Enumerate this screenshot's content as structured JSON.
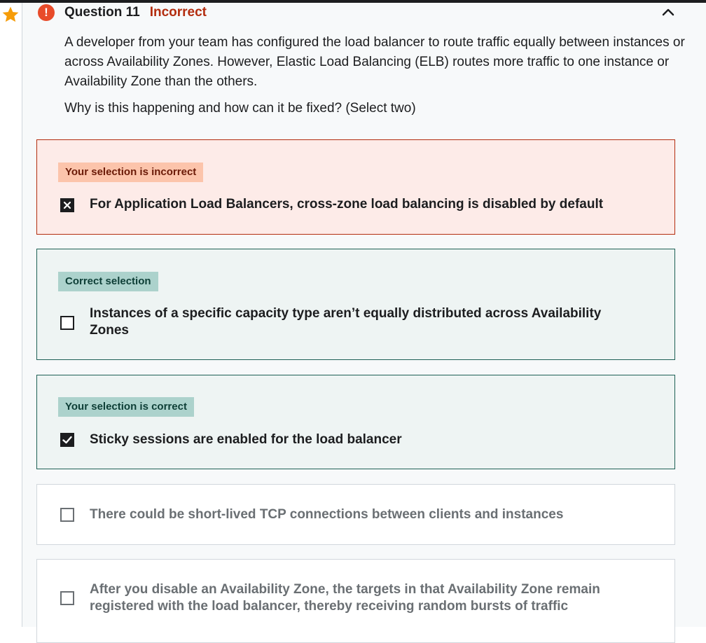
{
  "question": {
    "number_label": "Question 11",
    "status_label": "Incorrect",
    "text": "A developer from your team has configured the load balancer to route traffic equally between instances or across Availability Zones. However, Elastic Load Balancing (ELB) routes more traffic to one instance or Availability Zone than the others.",
    "prompt": "Why is this happening and how can it be fixed? (Select two)"
  },
  "icons": {
    "bookmark": "star-icon",
    "status": "exclamation-icon",
    "collapse": "chevron-up-icon"
  },
  "colors": {
    "accent_star": "#f69c08",
    "incorrect": "#b32d0f",
    "incorrect_bg": "#fdebe8",
    "correct_border": "#1e6055",
    "correct_bg": "#eef4f3"
  },
  "options": [
    {
      "badge": "Your selection is incorrect",
      "label": "For Application Load Balancers, cross-zone load balancing is disabled by default",
      "checked": true,
      "state": "incorrect"
    },
    {
      "badge": "Correct selection",
      "label": "Instances of a specific capacity type aren’t equally distributed across Availability Zones",
      "checked": false,
      "state": "correct"
    },
    {
      "badge": "Your selection is correct",
      "label": "Sticky sessions are enabled for the load balancer",
      "checked": true,
      "state": "correct"
    },
    {
      "badge": "",
      "label": "There could be short-lived TCP connections between clients and instances",
      "checked": false,
      "state": "neutral"
    },
    {
      "badge": "",
      "label": "After you disable an Availability Zone, the targets in that Availability Zone remain registered with the load balancer, thereby receiving random bursts of traffic",
      "checked": false,
      "state": "neutral"
    }
  ]
}
